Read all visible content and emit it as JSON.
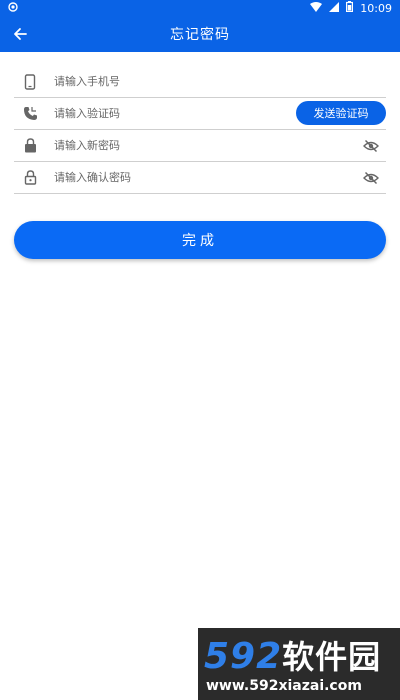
{
  "status_bar": {
    "time": "10:09"
  },
  "app_bar": {
    "title": "忘记密码"
  },
  "form": {
    "phone": {
      "placeholder": "请输入手机号"
    },
    "code": {
      "placeholder": "请输入验证码",
      "send_label": "发送验证码"
    },
    "new_password": {
      "placeholder": "请输入新密码"
    },
    "confirm_password": {
      "placeholder": "请输入确认密码"
    }
  },
  "submit": {
    "label": "完成"
  },
  "watermark": {
    "logo_num": "592",
    "logo_text": "软件园",
    "url": "www.592xiazai.com"
  },
  "colors": {
    "primary": "#0a63e6",
    "button": "#0a6af5",
    "divider": "#cfcfcf"
  }
}
